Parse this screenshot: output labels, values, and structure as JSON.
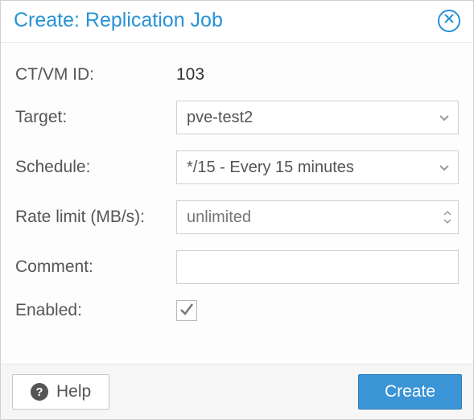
{
  "dialog": {
    "title": "Create: Replication Job"
  },
  "form": {
    "ctvm_label": "CT/VM ID:",
    "ctvm_value": "103",
    "target_label": "Target:",
    "target_value": "pve-test2",
    "schedule_label": "Schedule:",
    "schedule_value": "*/15 - Every 15 minutes",
    "rate_label": "Rate limit (MB/s):",
    "rate_placeholder": "unlimited",
    "rate_value": "",
    "comment_label": "Comment:",
    "comment_value": "",
    "enabled_label": "Enabled:",
    "enabled_checked": true
  },
  "footer": {
    "help_label": "Help",
    "create_label": "Create"
  },
  "colors": {
    "accent": "#2792d6",
    "primary_button": "#3a94d6"
  }
}
